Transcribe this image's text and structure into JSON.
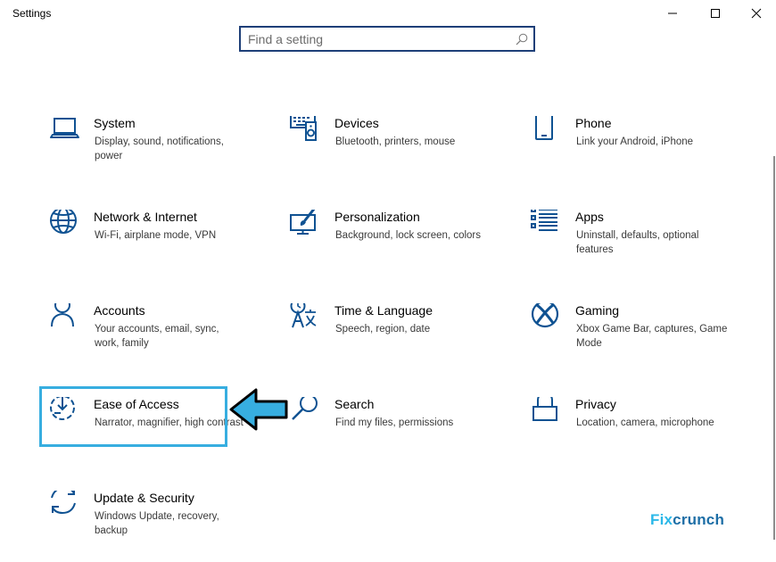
{
  "window": {
    "title": "Settings",
    "minimize_icon": "minimize-icon",
    "maximize_icon": "maximize-icon",
    "close_icon": "close-icon"
  },
  "search": {
    "placeholder": "Find a setting",
    "value": "",
    "icon": "search-icon"
  },
  "categories": [
    {
      "name": "System",
      "desc": "Display, sound, notifications, power",
      "icon": "laptop-icon"
    },
    {
      "name": "Devices",
      "desc": "Bluetooth, printers, mouse",
      "icon": "keyboard-speaker-icon"
    },
    {
      "name": "Phone",
      "desc": "Link your Android, iPhone",
      "icon": "phone-icon"
    },
    {
      "name": "Network & Internet",
      "desc": "Wi-Fi, airplane mode, VPN",
      "icon": "globe-icon"
    },
    {
      "name": "Personalization",
      "desc": "Background, lock screen, colors",
      "icon": "paint-brush-icon"
    },
    {
      "name": "Apps",
      "desc": "Uninstall, defaults, optional features",
      "icon": "apps-list-icon"
    },
    {
      "name": "Accounts",
      "desc": "Your accounts, email, sync, work, family",
      "icon": "person-icon"
    },
    {
      "name": "Time & Language",
      "desc": "Speech, region, date",
      "icon": "time-language-icon"
    },
    {
      "name": "Gaming",
      "desc": "Xbox Game Bar, captures, Game Mode",
      "icon": "xbox-icon"
    },
    {
      "name": "Ease of Access",
      "desc": "Narrator, magnifier, high contrast",
      "icon": "ease-of-access-icon"
    },
    {
      "name": "Search",
      "desc": "Find my files, permissions",
      "icon": "magnifier-icon"
    },
    {
      "name": "Privacy",
      "desc": "Location, camera, microphone",
      "icon": "lock-icon"
    },
    {
      "name": "Update & Security",
      "desc": "Windows Update, recovery, backup",
      "icon": "sync-icon"
    }
  ],
  "annotation": {
    "arrow_icon": "pointer-arrow-icon",
    "highlight_color": "#37aee0"
  },
  "watermark": {
    "part1": "Fix",
    "part2": "crunch"
  },
  "colors": {
    "accent": "#0f5292",
    "highlight": "#37aee0",
    "search_border": "#1e3f78"
  }
}
